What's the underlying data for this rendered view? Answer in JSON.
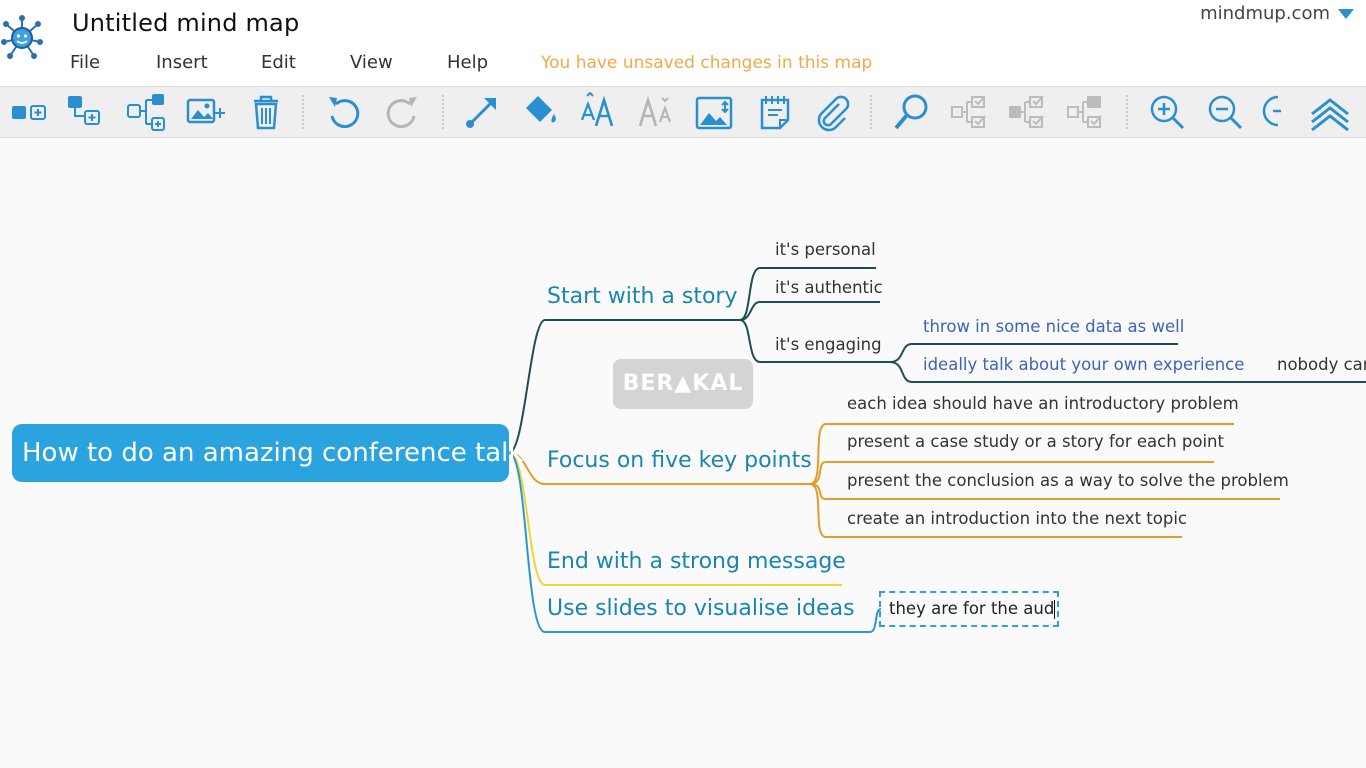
{
  "app": {
    "title": "Untitled mind map",
    "brand": "mindmup.com",
    "status": "You have unsaved changes in this map"
  },
  "menu": [
    "File",
    "Insert",
    "Edit",
    "View",
    "Help"
  ],
  "toolbar": [
    "add-child-icon",
    "add-sibling-icon",
    "insert-parent-icon",
    "add-image-icon",
    "delete-icon",
    "undo-icon",
    "redo-icon",
    "connect-icon",
    "fill-color-icon",
    "increase-font-icon",
    "decrease-font-icon",
    "background-image-icon",
    "notes-icon",
    "attachment-icon",
    "search-icon",
    "collapse-icon",
    "expand-icon",
    "toggle-icon",
    "zoom-in-icon",
    "zoom-out-icon",
    "zoom-reset-icon",
    "collapse-toolbar-icon"
  ],
  "colors": {
    "accent": "#2aa3de",
    "status": "#f0a94a",
    "branch_story": "#1f4d54",
    "branch_focus": "#e59b2a",
    "branch_end": "#f1d33a",
    "branch_slides": "#2a9bc9",
    "sub_blue": "#3b64b8"
  },
  "mindmap": {
    "root": "How to do an amazing conference talk",
    "branches": [
      {
        "label": "Start with a story",
        "children": [
          {
            "label": "it's personal"
          },
          {
            "label": "it's authentic"
          },
          {
            "label": "it's engaging",
            "children": [
              {
                "label": "throw in some nice data as well"
              },
              {
                "label": "ideally talk about your own experience",
                "children": [
                  {
                    "label": "nobody car"
                  }
                ]
              }
            ]
          }
        ]
      },
      {
        "label": "Focus on five key points",
        "children": [
          {
            "label": "each idea should have an introductory problem"
          },
          {
            "label": "present a case study or a story for each point"
          },
          {
            "label": "present the conclusion as a way to solve the problem"
          },
          {
            "label": "create an introduction into the next topic"
          }
        ]
      },
      {
        "label": "End with a strong message"
      },
      {
        "label": "Use slides to visualise ideas",
        "children": [
          {
            "label": "they are for the aud"
          }
        ]
      }
    ]
  },
  "watermark": "BER▲KAL"
}
